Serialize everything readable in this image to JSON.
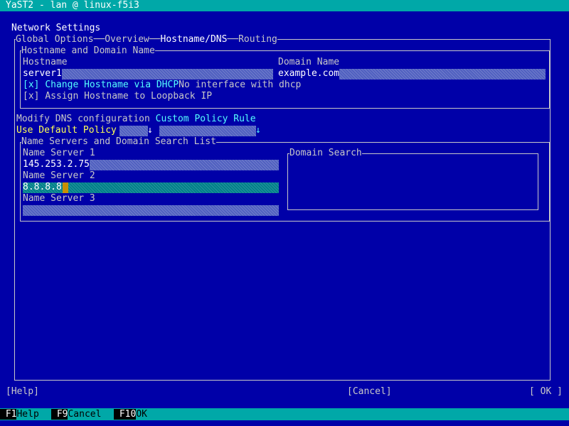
{
  "window": {
    "title": "YaST2 - lan @ linux-f5i3"
  },
  "dialog": {
    "title": "Network Settings"
  },
  "tabs": [
    {
      "label": "Global Options"
    },
    {
      "label": "Overview"
    },
    {
      "label": "Hostname/DNS"
    },
    {
      "label": "Routing"
    }
  ],
  "hostname_section": {
    "title": "Hostname and Domain Name",
    "hostname_label": "Hostname",
    "hostname_value": "server1",
    "domain_label": "Domain Name",
    "domain_value": "example.com",
    "dhcp_checkbox": {
      "mark": "[x]",
      "label": "Change Hostname via DHCP",
      "note": "No interface with dhcp"
    },
    "loopback_checkbox": {
      "mark": "[x]",
      "label": "Assign Hostname to Loopback IP"
    }
  },
  "dns_config": {
    "label": "Modify DNS configuration",
    "custom_label": "Custom Policy Rule",
    "selected": "Use Default Policy",
    "arrow": "↓",
    "custom_arrow": "↓"
  },
  "nameservers_section": {
    "title": "Name Servers and Domain Search List",
    "ns1_label": "Name Server 1",
    "ns1_value": "145.253.2.75",
    "ns2_label": "Name Server 2",
    "ns2_value": "8.8.8.8",
    "ns3_label": "Name Server 3",
    "ns3_value": "",
    "domain_search_label": "Domain Search"
  },
  "buttons": {
    "help": "[Help]",
    "cancel": "[Cancel]",
    "ok": "[ OK ]"
  },
  "fkeys": [
    {
      "key": "F1",
      "label": "Help"
    },
    {
      "key": "F9",
      "label": "Cancel"
    },
    {
      "key": "F10",
      "label": "OK"
    }
  ],
  "colors": {
    "background": "#0000a8",
    "titlebar": "#00a8a8",
    "highlight": "#ffff55",
    "link": "#55ffff"
  }
}
